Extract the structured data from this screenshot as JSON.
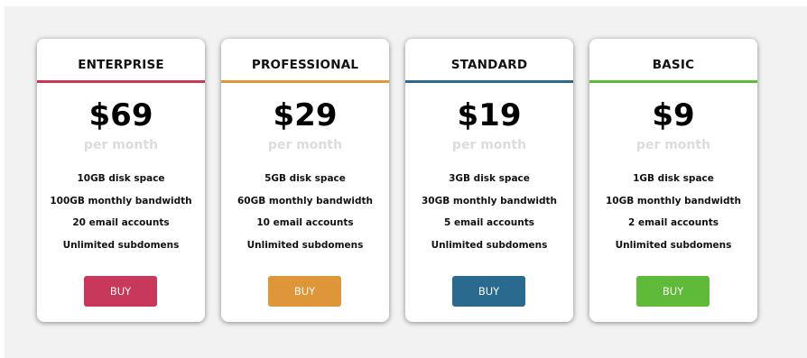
{
  "plans": [
    {
      "name": "ENTERPRISE",
      "price": "$69",
      "period": "per month",
      "features": [
        "10GB disk space",
        "100GB monthly bandwidth",
        "20 email accounts",
        "Unlimited subdomens"
      ],
      "button_label": "BUY",
      "accent": "#c8385a"
    },
    {
      "name": "PROFESSIONAL",
      "price": "$29",
      "period": "per month",
      "features": [
        "5GB disk space",
        "60GB monthly bandwidth",
        "10 email accounts",
        "Unlimited subdomens"
      ],
      "button_label": "BUY",
      "accent": "#de9638"
    },
    {
      "name": "STANDARD",
      "price": "$19",
      "period": "per month",
      "features": [
        "3GB disk space",
        "30GB monthly bandwidth",
        "5 email accounts",
        "Unlimited subdomens"
      ],
      "button_label": "BUY",
      "accent": "#2b6a8f"
    },
    {
      "name": "BASIC",
      "price": "$9",
      "period": "per month",
      "features": [
        "1GB disk space",
        "10GB monthly bandwidth",
        "2 email accounts",
        "Unlimited subdomens"
      ],
      "button_label": "BUY",
      "accent": "#5fba3a"
    }
  ]
}
